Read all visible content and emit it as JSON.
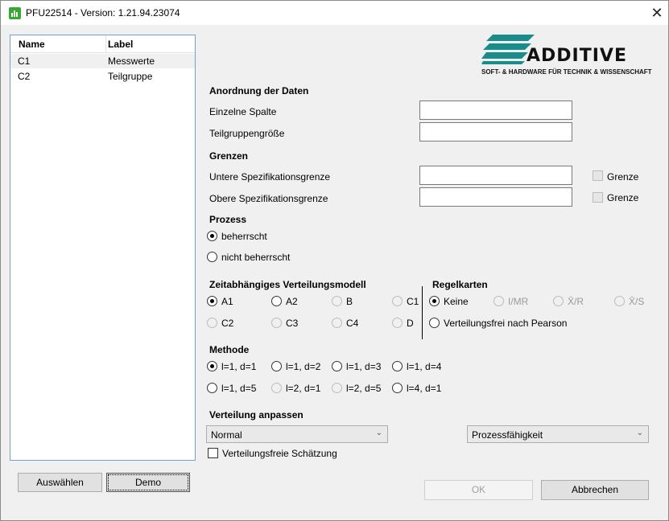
{
  "window": {
    "title": "PFU22514 - Version: 1.21.94.23074"
  },
  "list": {
    "headers": {
      "name": "Name",
      "label": "Label"
    },
    "rows": [
      {
        "name": "C1",
        "label": "Messwerte"
      },
      {
        "name": "C2",
        "label": "Teilgruppe"
      }
    ]
  },
  "buttons": {
    "select": "Auswählen",
    "demo": "Demo",
    "ok": "OK",
    "cancel": "Abbrechen"
  },
  "logo": {
    "brand": "ADDITIVE",
    "tagline": "SOFT- & HARDWARE FÜR TECHNIK & WISSENSCHAFT"
  },
  "data_arrangement": {
    "title": "Anordnung der Daten",
    "single_column": "Einzelne Spalte",
    "subgroup_size": "Teilgruppengröße",
    "single_column_value": "",
    "subgroup_size_value": ""
  },
  "limits": {
    "title": "Grenzen",
    "lower": "Untere Spezifikationsgrenze",
    "upper": "Obere Spezifikationsgrenze",
    "bound": "Grenze",
    "lower_value": "",
    "upper_value": ""
  },
  "process": {
    "title": "Prozess",
    "controlled": "beherrscht",
    "uncontrolled": "nicht beherrscht"
  },
  "model": {
    "title": "Zeitabhängiges Verteilungsmodell",
    "options": [
      "A1",
      "A2",
      "B",
      "C1",
      "C2",
      "C3",
      "C4",
      "D"
    ]
  },
  "control_charts": {
    "title": "Regelkarten",
    "options": [
      "Keine",
      "I/MR",
      "X̄/R",
      "X̄/S"
    ],
    "pearson": "Verteilungsfrei nach Pearson"
  },
  "method": {
    "title": "Methode",
    "options": [
      "l=1, d=1",
      "l=1, d=2",
      "l=1, d=3",
      "l=1, d=4",
      "l=1, d=5",
      "l=2, d=1",
      "l=2, d=5",
      "l=4, d=1"
    ]
  },
  "fit": {
    "title": "Verteilung anpassen",
    "distribution": "Normal",
    "capability": "Prozessfähigkeit",
    "nonparametric": "Verteilungsfreie Schätzung"
  }
}
